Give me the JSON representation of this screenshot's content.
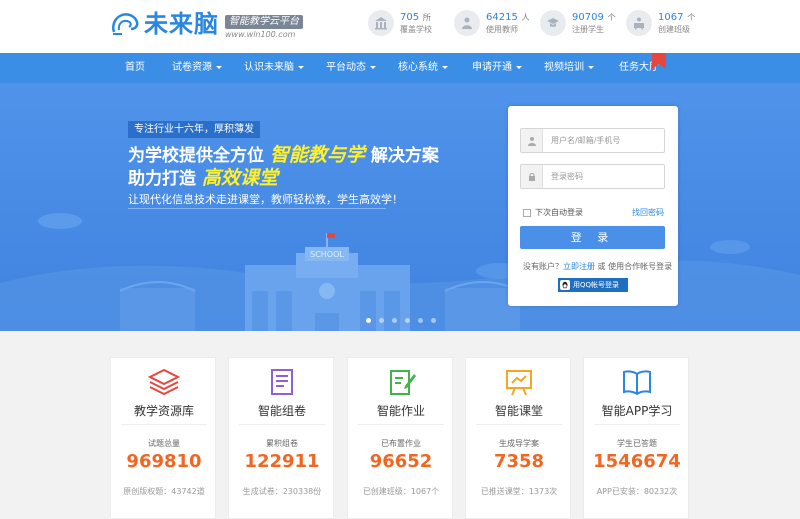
{
  "header": {
    "logo_text": "未来脑",
    "logo_slogan": "智能教学云平台",
    "logo_url": "www.wln100.com",
    "stats": [
      {
        "icon": "school-icon",
        "num": "705",
        "unit": "所",
        "label": "覆盖学校"
      },
      {
        "icon": "teacher-icon",
        "num": "64215",
        "unit": "人",
        "label": "使用教师"
      },
      {
        "icon": "student-icon",
        "num": "90709",
        "unit": "个",
        "label": "注册学生"
      },
      {
        "icon": "class-icon",
        "num": "1067",
        "unit": "个",
        "label": "创建班级"
      }
    ]
  },
  "nav": {
    "items": [
      {
        "label": "首页"
      },
      {
        "label": "试卷资源"
      },
      {
        "label": "认识未来脑"
      },
      {
        "label": "平台动态"
      },
      {
        "label": "核心系统"
      },
      {
        "label": "申请开通"
      },
      {
        "label": "视频培训"
      },
      {
        "label": "任务大厅"
      }
    ]
  },
  "hero": {
    "tagline": "专注行业十六年，厚积薄发",
    "line1_pre": "为学校提供全方位",
    "line1_hl": "智能教与学",
    "line1_post": "解决方案",
    "line2_pre": "助力打造",
    "line2_hl": "高效课堂",
    "sub": "让现代化信息技术走进课堂，教师轻松教，学生高效学！",
    "school_sign": "SCHOOL"
  },
  "login": {
    "username_placeholder": "用户名/邮箱/手机号",
    "password_placeholder": "登录密码",
    "remember_label": "下次自动登录",
    "forgot_label": "找回密码",
    "submit_label": "登 录",
    "noacc_prefix": "没有账户？",
    "register_label": "立即注册",
    "noacc_mid": "或 使用合作帐号登录",
    "qq_label": "用QQ帐号登录"
  },
  "cards": [
    {
      "title": "教学资源库",
      "label": "试题总量",
      "num": "969810",
      "foot": "原创版权题：43742道",
      "color": "#e8453c"
    },
    {
      "title": "智能组卷",
      "label": "累积组卷",
      "num": "122911",
      "foot": "生成试卷：230338份",
      "color": "#8f5fd6"
    },
    {
      "title": "智能作业",
      "label": "已布置作业",
      "num": "96652",
      "foot": "已创建班级：1067个",
      "color": "#41b34a"
    },
    {
      "title": "智能课堂",
      "label": "生成导学案",
      "num": "7358",
      "foot": "已推送课堂：1373次",
      "color": "#f5a623"
    },
    {
      "title": "智能APP学习",
      "label": "学生已答题",
      "num": "1546674",
      "foot": "APP已安装：80232次",
      "color": "#2a86e0"
    }
  ]
}
